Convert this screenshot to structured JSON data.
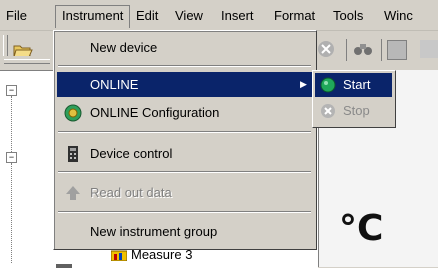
{
  "menubar": {
    "items": [
      "File",
      "Instrument",
      "Edit",
      "View",
      "Insert",
      "Format",
      "Tools",
      "Winc"
    ]
  },
  "instrument_menu": {
    "new_device": "New device",
    "online": "ONLINE",
    "online_configuration": "ONLINE Configuration",
    "device_control": "Device control",
    "read_out_data": "Read out data",
    "new_instrument_group": "New instrument group"
  },
  "online_submenu": {
    "start": "Start",
    "stop": "Stop"
  },
  "tree": {
    "partial_item": "Measure 3"
  },
  "canvas": {
    "percent_text": "%",
    "celsius_text": "°C"
  },
  "colors": {
    "highlight": "#0a246a",
    "start_icon": "#1fa85a",
    "menu_bg": "#d4d0c8"
  }
}
